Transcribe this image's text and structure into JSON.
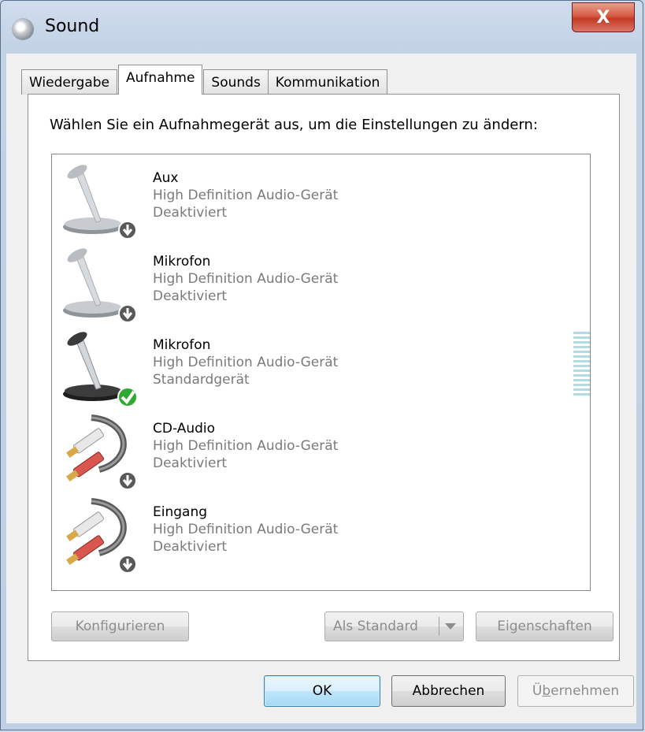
{
  "window": {
    "title": "Sound",
    "close_label": "X"
  },
  "tabs": [
    {
      "label": "Wiedergabe",
      "active": false
    },
    {
      "label": "Aufnahme",
      "active": true
    },
    {
      "label": "Sounds",
      "active": false
    },
    {
      "label": "Kommunikation",
      "active": false
    }
  ],
  "panel": {
    "instruction": "Wählen Sie ein Aufnahmegerät aus, um die Einstellungen zu ändern:",
    "devices": [
      {
        "name": "Aux",
        "description": "High Definition Audio-Gerät",
        "status": "Deaktiviert",
        "icon": "microphone-icon",
        "badge": "down-arrow-badge-icon"
      },
      {
        "name": "Mikrofon",
        "description": "High Definition Audio-Gerät",
        "status": "Deaktiviert",
        "icon": "microphone-icon",
        "badge": "down-arrow-badge-icon"
      },
      {
        "name": "Mikrofon",
        "description": "High Definition Audio-Gerät",
        "status": "Standardgerät",
        "icon": "microphone-icon",
        "badge": "green-checkmark-badge-icon",
        "level": 0
      },
      {
        "name": "CD-Audio",
        "description": "High Definition Audio-Gerät",
        "status": "Deaktiviert",
        "icon": "rca-cable-icon",
        "badge": "down-arrow-badge-icon"
      },
      {
        "name": "Eingang",
        "description": "High Definition Audio-Gerät",
        "status": "Deaktiviert",
        "icon": "rca-cable-icon",
        "badge": "down-arrow-badge-icon"
      }
    ],
    "buttons": {
      "configure": "Konfigurieren",
      "set_default": "Als Standard",
      "properties": "Eigenschaften"
    }
  },
  "dialog_buttons": {
    "ok": "OK",
    "cancel": "Abbrechen",
    "apply_prefix": "Ü",
    "apply_underlined": "b",
    "apply_rest": "ernehmen"
  },
  "colors": {
    "disabled_text": "#8d8d8d",
    "status_text": "#7a7a7a",
    "close_button": "#c33a22",
    "level_meter": "#aedbe4",
    "checkmark": "#2fa92f"
  }
}
